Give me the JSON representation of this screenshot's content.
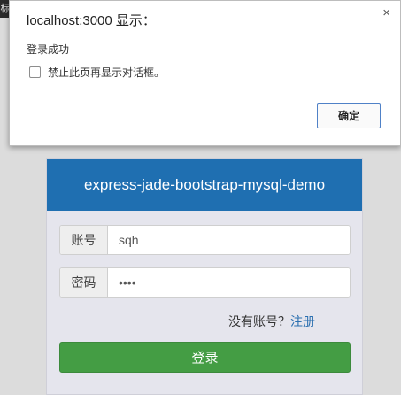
{
  "tab_fragment": {
    "text": "标"
  },
  "dialog": {
    "title": "localhost:3000 显示：",
    "message": "登录成功",
    "checkbox_label": "禁止此页再显示对话框。",
    "ok_label": "确定",
    "close_glyph": "×"
  },
  "login": {
    "header_title": "express-jade-bootstrap-mysql-demo",
    "username_label": "账号",
    "username_value": "sqh",
    "password_label": "密码",
    "password_value": "sqhx",
    "register_prompt": "没有账号？",
    "register_link": "注册",
    "submit_label": "登录"
  },
  "colors": {
    "header_bg": "#1f6fb1",
    "submit_bg": "#449d44",
    "link": "#2a6fb0"
  }
}
